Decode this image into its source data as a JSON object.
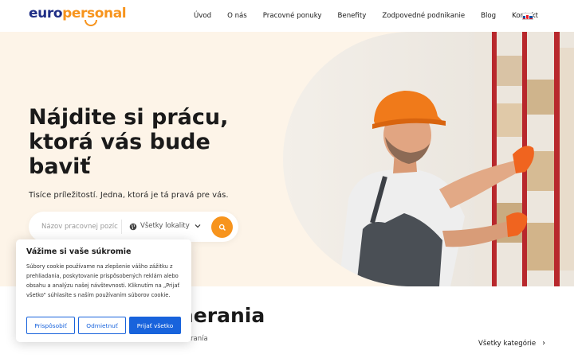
{
  "header": {
    "logo": {
      "part1": "euro",
      "part2": "personal"
    },
    "nav": [
      {
        "label": "Úvod"
      },
      {
        "label": "O nás"
      },
      {
        "label": "Pracovné ponuky"
      },
      {
        "label": "Benefity"
      },
      {
        "label": "Zodpovedné podnikanie"
      },
      {
        "label": "Blog"
      },
      {
        "label": "Kontakt"
      }
    ],
    "language_icon": "slovak-flag-icon"
  },
  "hero": {
    "title": "Nájdite si prácu, ktorá vás bude baviť",
    "subtitle": "Tisíce príležitostí. Jedna, ktorá je tá pravá pre vás.",
    "search": {
      "placeholder": "Názov pracovnej pozície",
      "location_label": "Všetky lokality",
      "location_icon": "globe-icon",
      "button_icon": "search-icon"
    }
  },
  "categories": {
    "heading": "nerania",
    "subtitle": "ranía",
    "all_link": "Všetky kategórie"
  },
  "cookie_banner": {
    "title": "Vážime si vaše súkromie",
    "text": "Súbory cookie používame na zlepšenie vášho zážitku z prehliadania, poskytovanie prispôsobených reklám alebo obsahu a analýzu našej návštevnosti. Kliknutím na „Prijať všetko“ súhlasíte s naším používaním súborov cookie.",
    "buttons": {
      "customize": "Prispôsobiť",
      "reject": "Odmietnuť",
      "accept": "Prijať všetko"
    }
  },
  "colors": {
    "brand_blue": "#1f2e86",
    "brand_orange": "#f7941d",
    "cookie_blue": "#1863dc",
    "hero_bg": "#fdf4e8"
  }
}
